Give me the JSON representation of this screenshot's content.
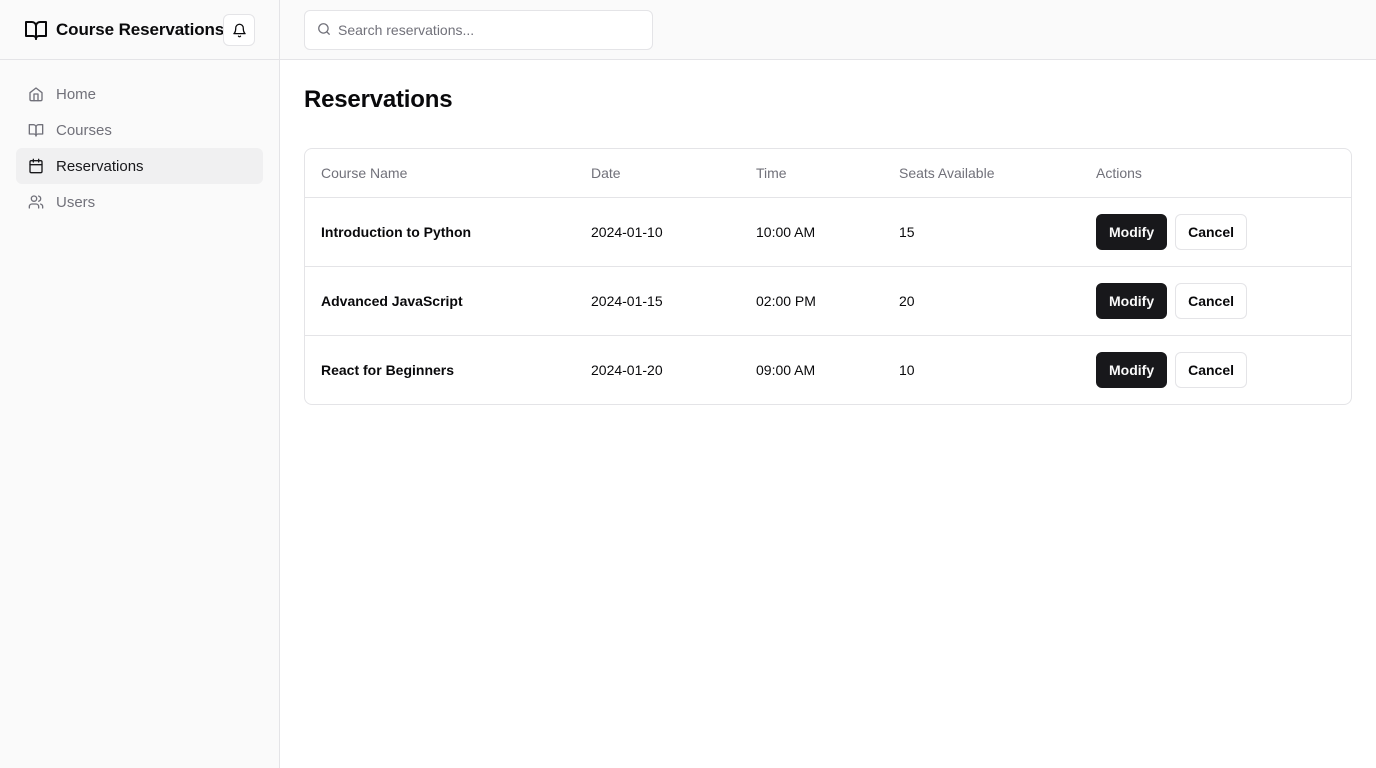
{
  "app": {
    "title": "Course Reservations",
    "brand_icon": "book-open-icon",
    "notifications_icon": "bell-icon"
  },
  "sidebar": {
    "items": [
      {
        "label": "Home",
        "icon": "home-icon",
        "active": false
      },
      {
        "label": "Courses",
        "icon": "book-open-icon",
        "active": false
      },
      {
        "label": "Reservations",
        "icon": "calendar-icon",
        "active": true
      },
      {
        "label": "Users",
        "icon": "users-icon",
        "active": false
      }
    ]
  },
  "search": {
    "placeholder": "Search reservations...",
    "value": "",
    "icon": "search-icon"
  },
  "main": {
    "title": "Reservations",
    "table": {
      "columns": [
        "Course Name",
        "Date",
        "Time",
        "Seats Available",
        "Actions"
      ],
      "rows": [
        {
          "course": "Introduction to Python",
          "date": "2024-01-10",
          "time": "10:00 AM",
          "seats": "15"
        },
        {
          "course": "Advanced JavaScript",
          "date": "2024-01-15",
          "time": "02:00 PM",
          "seats": "20"
        },
        {
          "course": "React for Beginners",
          "date": "2024-01-20",
          "time": "09:00 AM",
          "seats": "10"
        }
      ],
      "actions": {
        "modify_label": "Modify",
        "cancel_label": "Cancel"
      }
    }
  },
  "colors": {
    "primary_button": "#18181b",
    "sidebar_bg": "#fafafa",
    "active_nav_bg": "#f0f0f1",
    "border": "#e4e4e7",
    "muted_text": "#71717a"
  }
}
